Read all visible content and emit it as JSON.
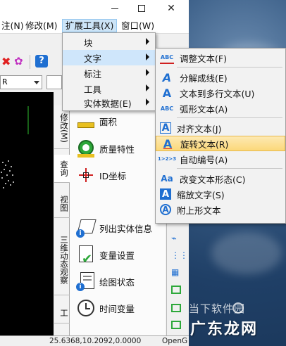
{
  "menubar": {
    "items": [
      {
        "label": "注(N)"
      },
      {
        "label": "修改(M)"
      },
      {
        "label": "扩展工具(X)"
      },
      {
        "label": "窗口(W)"
      }
    ]
  },
  "toolbar2": {
    "dropdown_value": "R"
  },
  "palette": {
    "tabs": [
      {
        "label": "修改(M)"
      },
      {
        "label": "查询"
      },
      {
        "label": "视图"
      },
      {
        "label": "三维动态观察"
      },
      {
        "label": "工"
      }
    ],
    "items": [
      {
        "label": "面积"
      },
      {
        "label": "质量特性"
      },
      {
        "label": "ID坐标"
      },
      {
        "label": "列出实体信息"
      },
      {
        "label": "变量设置"
      },
      {
        "label": "绘图状态"
      },
      {
        "label": "时间变量"
      }
    ]
  },
  "ext_menu": {
    "items": [
      {
        "label": "块"
      },
      {
        "label": "文字"
      },
      {
        "label": "标注"
      },
      {
        "label": "工具"
      },
      {
        "label": "实体数据(E)"
      }
    ]
  },
  "text_submenu": {
    "items": [
      {
        "label": "调整文本(F)",
        "icon": "ABC"
      },
      {
        "label": "分解成线(E)",
        "icon": "A"
      },
      {
        "label": "文本到多行文本(U)",
        "icon": "A"
      },
      {
        "label": "弧形文本(A)",
        "icon": "ABC"
      },
      {
        "label": "对齐文本(J)",
        "icon": "A"
      },
      {
        "label": "旋转文本(R)",
        "icon": "A"
      },
      {
        "label": "自动编号(A)",
        "icon": "1>2>3"
      },
      {
        "label": "改变文本形态(C)",
        "icon": "Aa"
      },
      {
        "label": "缩放文字(S)",
        "icon": "A"
      },
      {
        "label": "附上形文本",
        "icon": "A"
      }
    ]
  },
  "statusbar": {
    "coords": "25.6368,10.2092,0.0000",
    "mode": "OpenG"
  },
  "watermark": {
    "line1": "当下软件园",
    "line2": "广东龙网"
  },
  "colors": {
    "accent": "#1f6fd1",
    "highlight": "#fbd87a",
    "menu_hover": "#cfe6fb"
  }
}
